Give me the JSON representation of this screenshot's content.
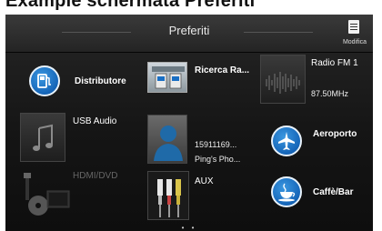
{
  "caption": "Example schermata Preferiti",
  "header": {
    "title": "Preferiti",
    "modifica_label": "Modifica"
  },
  "tiles": {
    "distributore": {
      "label": "Distributore",
      "icon": "fuel-pump-icon"
    },
    "ricerca": {
      "label": "Ricerca Ra...",
      "icon": "poi-search-icon"
    },
    "radio": {
      "label": "Radio FM 1",
      "frequency": "87.50MHz",
      "icon": "radio-waveform-icon"
    },
    "usb_audio": {
      "label": "USB Audio",
      "icon": "music-note-icon"
    },
    "contact": {
      "number": "15911169...",
      "name": "Ping's Pho...",
      "icon": "person-silhouette-icon"
    },
    "aeroporto": {
      "label": "Aeroporto",
      "icon": "airplane-icon"
    },
    "hdmi": {
      "label": "HDMI/DVD",
      "icon": "hdmi-dvd-icon"
    },
    "aux": {
      "label": "AUX",
      "icon": "rca-cable-icon"
    },
    "caffe": {
      "label": "Caffè/Bar",
      "icon": "coffee-cup-icon"
    }
  },
  "pager": "• •",
  "colors": {
    "accent_blue": "#1a6fc4",
    "background": "#151515"
  }
}
